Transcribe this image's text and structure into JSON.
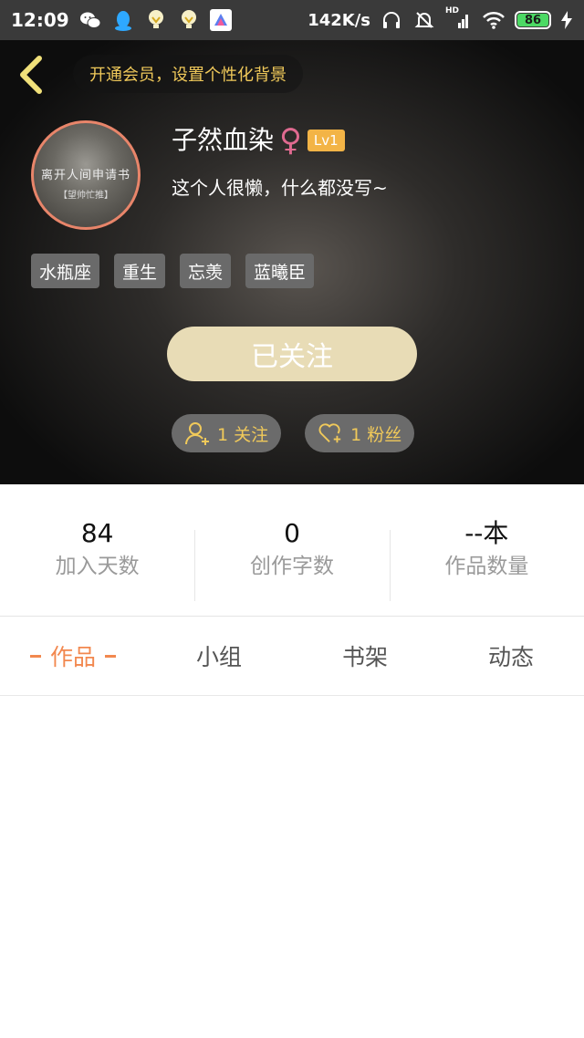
{
  "status_bar": {
    "time": "12:09",
    "network_speed": "142K/s",
    "network_type": "HD",
    "battery": "86",
    "icons": [
      "wechat-icon",
      "qq-icon",
      "bulb-icon",
      "bulb-icon",
      "app-tile-icon",
      "headphones-icon",
      "mute-bell-icon",
      "signal-icon",
      "wifi-icon",
      "battery-icon",
      "charging-icon"
    ]
  },
  "header": {
    "vip_banner": "开通会员，设置个性化背景",
    "avatar_text": "离开人间申请书",
    "avatar_subtext": "【望帅忙推】",
    "username": "子然血染",
    "gender_symbol": "♀",
    "level": "Lv1",
    "bio": "这个人很懒，什么都没写~",
    "tags": [
      "水瓶座",
      "重生",
      "忘羡",
      "蓝曦臣"
    ],
    "follow_button": "已关注",
    "following_label": "1 关注",
    "followers_label": "1 粉丝"
  },
  "stats": [
    {
      "value": "84",
      "label": "加入天数"
    },
    {
      "value": "0",
      "label": "创作字数"
    },
    {
      "value": "--本",
      "label": "作品数量"
    }
  ],
  "tabs": [
    {
      "label": "作品",
      "active": true
    },
    {
      "label": "小组",
      "active": false
    },
    {
      "label": "书架",
      "active": false
    },
    {
      "label": "动态",
      "active": false
    }
  ],
  "colors": {
    "accent": "#f2884f",
    "gold": "#f0c95a",
    "follow_button": "#e8dcb6",
    "level_badge": "#f3b446",
    "gender": "#e06a90",
    "avatar_ring": "#e8856a"
  }
}
